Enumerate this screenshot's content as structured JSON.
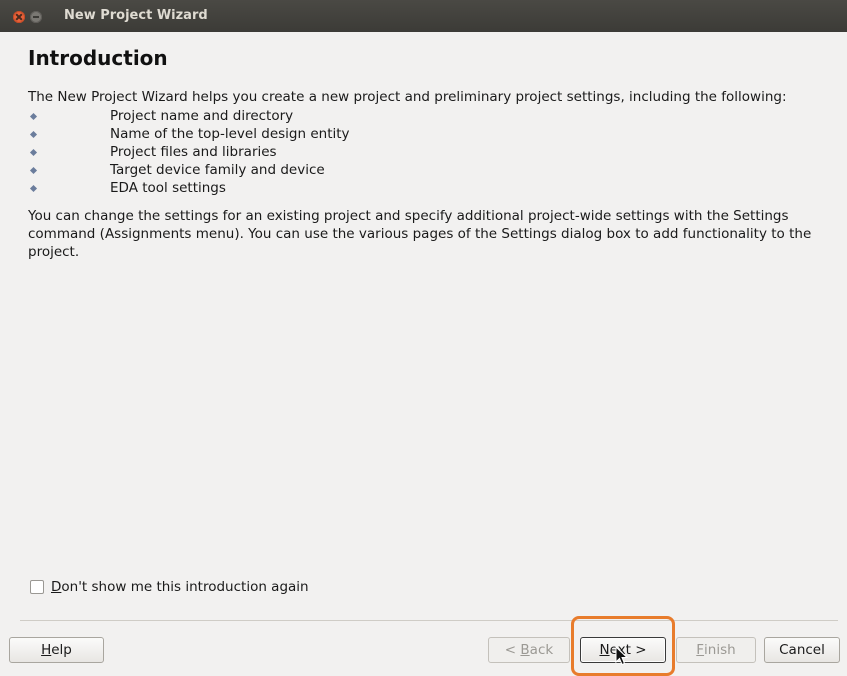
{
  "window": {
    "title": "New Project Wizard"
  },
  "page": {
    "heading": "Introduction",
    "intro": "The New Project Wizard helps you create a new project and preliminary project settings, including the following:",
    "items": [
      "Project name and directory",
      "Name of the top-level design entity",
      "Project files and libraries",
      "Target device family and device",
      "EDA tool settings"
    ],
    "paragraph": "You can change the settings for an existing project and specify additional project-wide settings with the Settings command (Assignments menu). You can use the various pages of the Settings dialog box to add functionality to the project."
  },
  "checkbox": {
    "label_mnemonic": "D",
    "label_rest": "on't show me this introduction again",
    "checked": false
  },
  "buttons": {
    "help": {
      "mnemonic": "H",
      "rest": "elp"
    },
    "back": {
      "prefix": "< ",
      "mnemonic": "B",
      "rest": "ack",
      "enabled": false
    },
    "next": {
      "mnemonic": "N",
      "rest": "ext >",
      "enabled": true
    },
    "finish": {
      "mnemonic": "F",
      "rest": "inish",
      "enabled": false
    },
    "cancel": {
      "label": "Cancel"
    }
  },
  "colors": {
    "highlight": "#e87c2c",
    "titlebar": "#3c3b37",
    "background": "#f2f1f0"
  }
}
